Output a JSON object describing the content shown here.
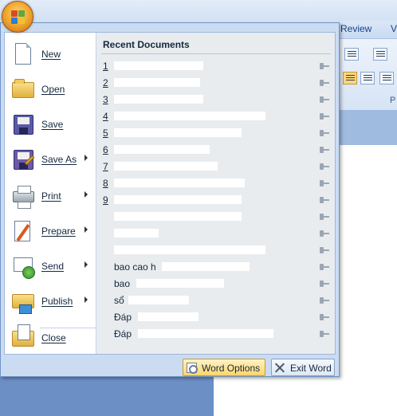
{
  "ribbon": {
    "tabs": [
      "Review",
      "V"
    ],
    "group_label": "P"
  },
  "office_button": {
    "icon": "office-logo-icon"
  },
  "menu": {
    "items": [
      {
        "label": "New",
        "icon": "new-document-icon",
        "has_submenu": false
      },
      {
        "label": "Open",
        "icon": "open-folder-icon",
        "has_submenu": false
      },
      {
        "label": "Save",
        "icon": "save-disk-icon",
        "has_submenu": false
      },
      {
        "label": "Save As",
        "icon": "save-as-icon",
        "has_submenu": true
      },
      {
        "label": "Print",
        "icon": "printer-icon",
        "has_submenu": true
      },
      {
        "label": "Prepare",
        "icon": "prepare-icon",
        "has_submenu": true
      },
      {
        "label": "Send",
        "icon": "send-icon",
        "has_submenu": true
      },
      {
        "label": "Publish",
        "icon": "publish-icon",
        "has_submenu": true
      },
      {
        "label": "Close",
        "icon": "close-folder-icon",
        "has_submenu": false
      }
    ]
  },
  "recent": {
    "title": "Recent Documents",
    "items": [
      {
        "num": "1",
        "name": ""
      },
      {
        "num": "2",
        "name": ""
      },
      {
        "num": "3",
        "name": ""
      },
      {
        "num": "4",
        "name": ""
      },
      {
        "num": "5",
        "name": ""
      },
      {
        "num": "6",
        "name": ""
      },
      {
        "num": "7",
        "name": ""
      },
      {
        "num": "8",
        "name": ""
      },
      {
        "num": "9",
        "name": ""
      },
      {
        "num": "",
        "name": ""
      },
      {
        "num": "",
        "name": ""
      },
      {
        "num": "",
        "name": ""
      },
      {
        "num": "",
        "name": "bao cao h"
      },
      {
        "num": "",
        "name": "bao"
      },
      {
        "num": "",
        "name": "sổ"
      },
      {
        "num": "",
        "name": "Đáp"
      },
      {
        "num": "",
        "name": "Đáp"
      }
    ]
  },
  "buttons": {
    "word_options": "Word Options",
    "exit_word": "Exit Word"
  },
  "colors": {
    "menu_bg": "#cbdcf2",
    "recent_pane_bg": "#e9ecee",
    "word_options_highlight": "#ffd56a"
  }
}
